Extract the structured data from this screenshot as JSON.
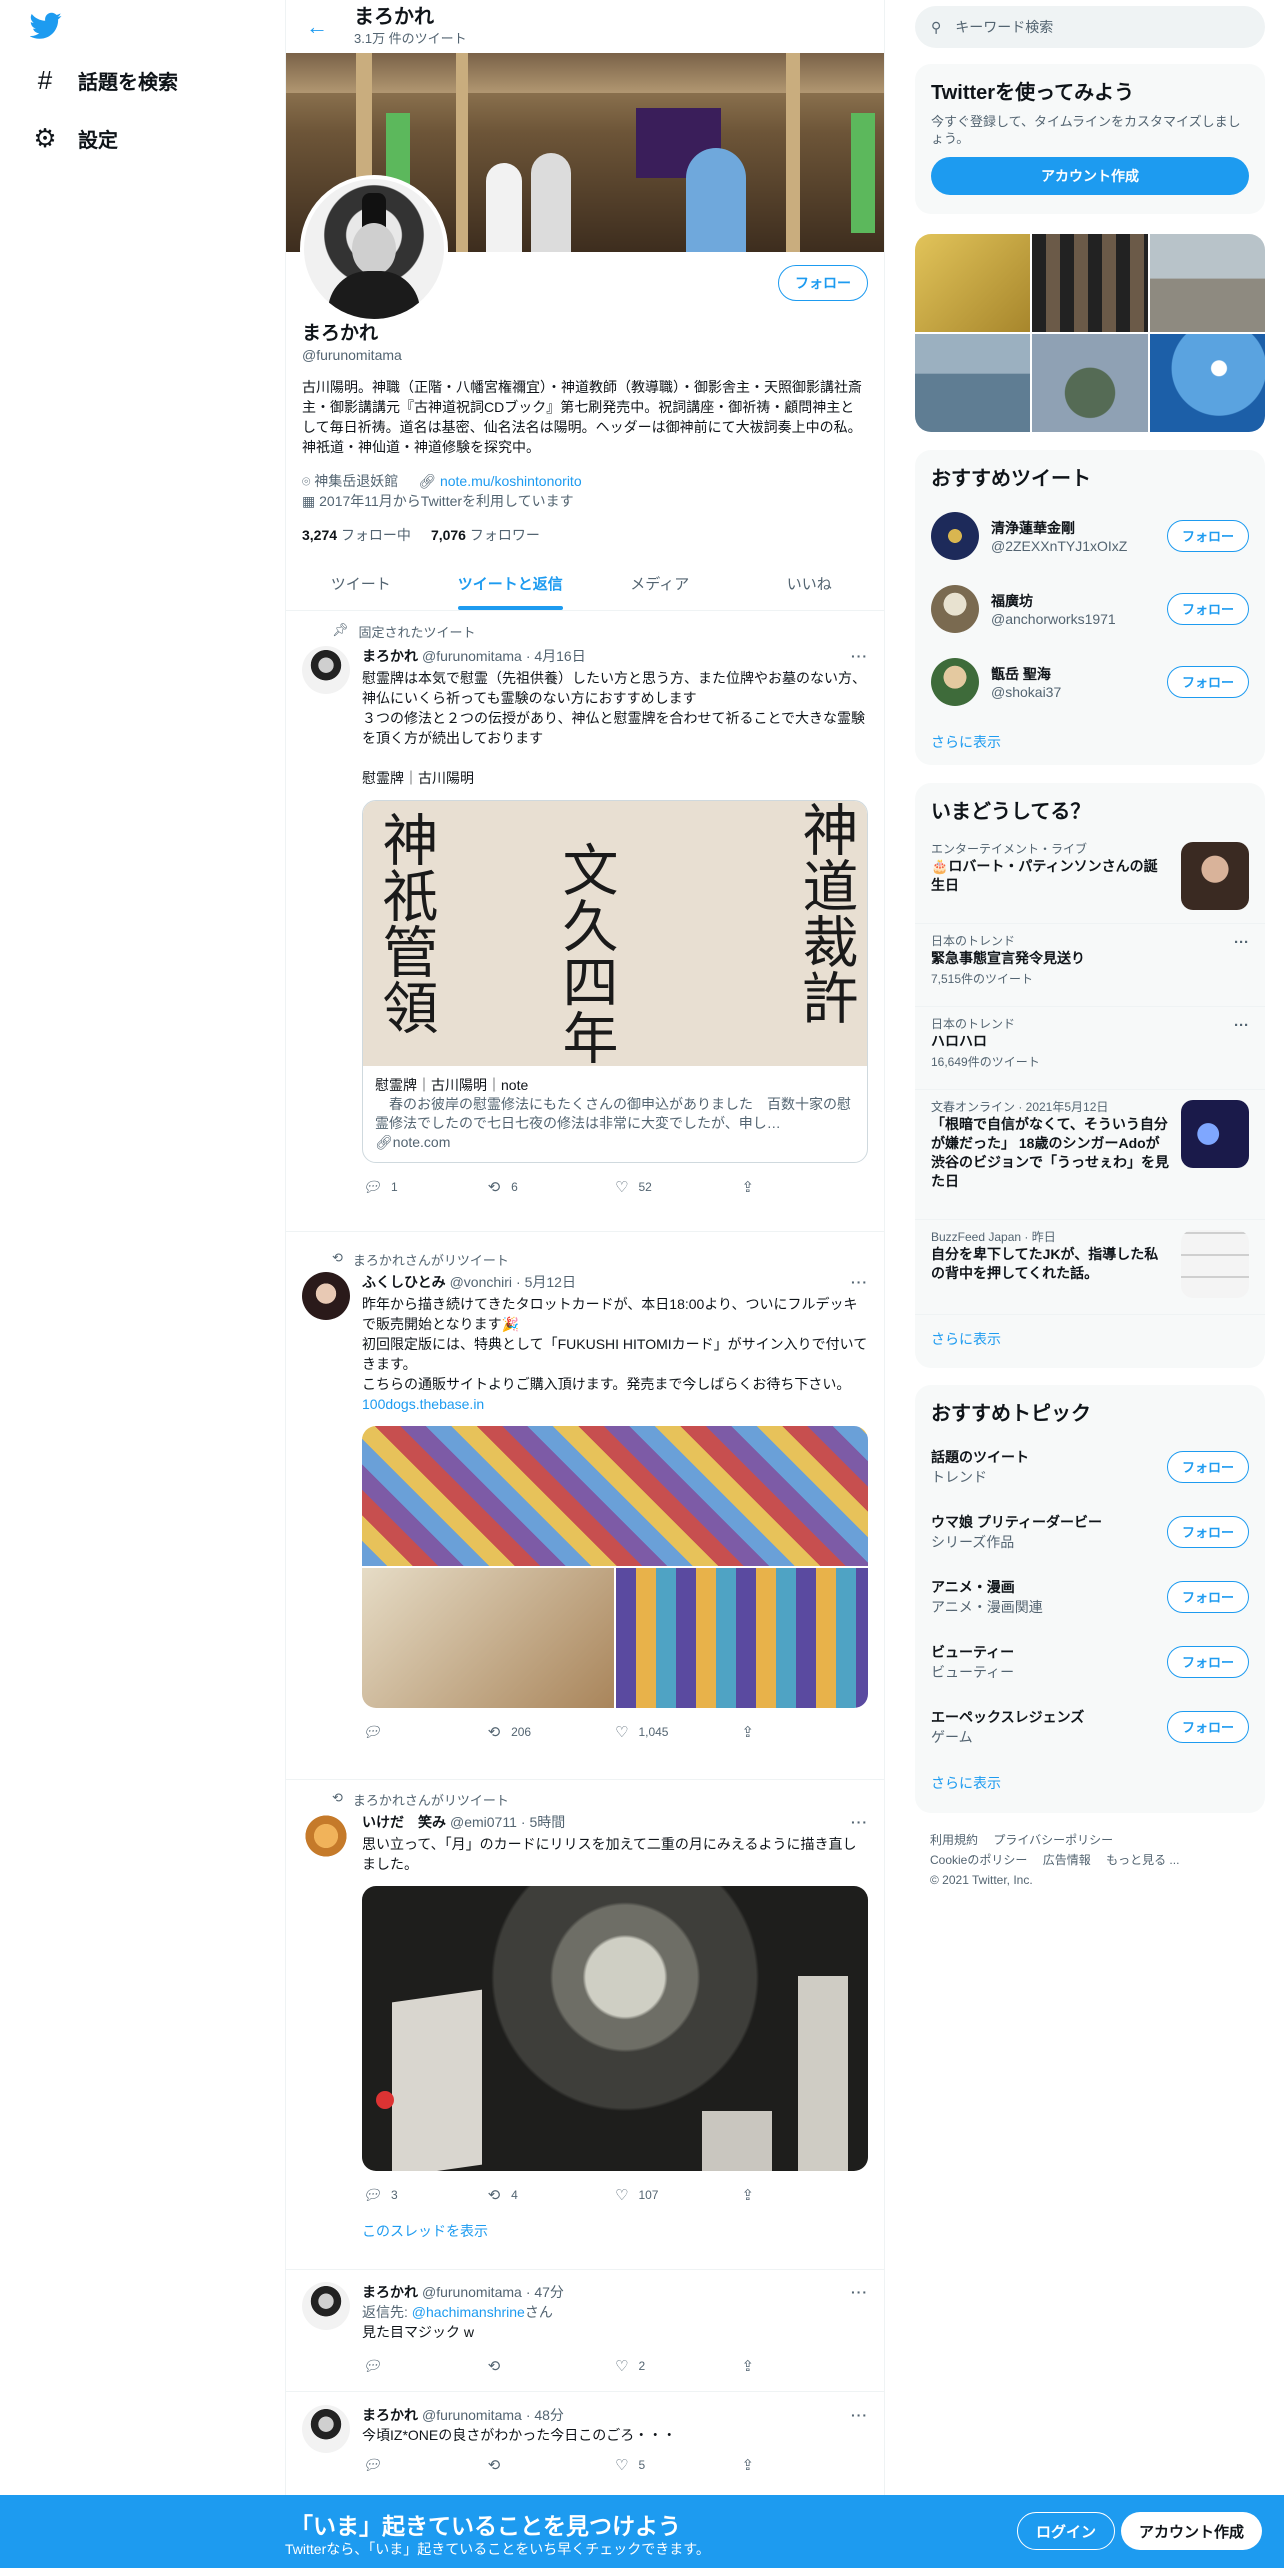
{
  "nav": {
    "explore": "話題を検索",
    "settings": "設定"
  },
  "header": {
    "name": "まろかれ",
    "tweet_count": "3.1万 件のツイート"
  },
  "profile": {
    "follow": "フォロー",
    "name": "まろかれ",
    "handle": "@furunomitama",
    "bio": "古川陽明。神職（正階・八幡宮権禰宜）・神道教師（教導職）・御影舎主・天照御影講社斎主・御影講講元『古神道祝詞CDブック』第七刷発売中。祝詞講座・御祈祷・顧問神主として毎日祈祷。道名は基密、仙名法名は陽明。ヘッダーは御神前にて大祓詞奏上中の私。神祇道・神仙道・神道修験を探究中。",
    "location": "神集岳退妖館",
    "url": "note.mu/koshintonorito",
    "joined": "2017年11月からTwitterを利用しています",
    "following_num": "3,274",
    "following_label": "フォロー中",
    "followers_num": "7,076",
    "followers_label": "フォロワー"
  },
  "tabs": [
    "ツイート",
    "ツイートと返信",
    "メディア",
    "いいね"
  ],
  "tweets": [
    {
      "context": "固定されたツイート",
      "name": "まろかれ",
      "handle": "@furunomitama",
      "time": "· 4月16日",
      "text": "慰霊牌は本気で慰霊（先祖供養）したい方と思う方、また位牌やお墓のない方、神仏にいくら祈っても霊験のない方におすすめします\n３つの修法と２つの伝授があり、神仏と慰霊牌を合わせて祈ることで大きな霊験を頂く方が続出しております\n\n慰霊牌｜古川陽明",
      "card_title": "慰霊牌｜古川陽明｜note",
      "card_desc": "　春のお彼岸の慰霊修法にもたくさんの御申込がありました　百数十家の慰霊修法でしたので七日七夜の修法は非常に大変でしたが、申し…",
      "card_url": "note.com",
      "card_kanji_1": "神道裁許",
      "card_kanji_2": "文久四年",
      "card_kanji_3": "神祇管領",
      "replies": "1",
      "retweets": "6",
      "likes": "52"
    },
    {
      "context": "まろかれさんがリツイート",
      "name": "ふくしひとみ",
      "handle": "@vonchiri",
      "time": "· 5月12日",
      "text": "昨年から描き続けてきたタロットカードが、本日18:00より、ついにフルデッキで販売開始となります🎉\n初回限定版には、特典として「FUKUSHI HITOMIカード」がサイン入りで付いてきます。\nこちらの通販サイトよりご購入頂けます。発売まで今しばらくお待ち下さい。",
      "link": "100dogs.thebase.in",
      "replies": "",
      "retweets": "206",
      "likes": "1,045"
    },
    {
      "context": "まろかれさんがリツイート",
      "name": "いけだ　笑み",
      "handle": "@emi0711",
      "time": "· 5時間",
      "text": "思い立って、「月」のカードにリリスを加えて二重の月にみえるように描き直しました。",
      "replies": "3",
      "retweets": "4",
      "likes": "107",
      "thread": "このスレッドを表示"
    },
    {
      "name": "まろかれ",
      "handle": "@furunomitama",
      "time": "· 47分",
      "reply_to_label": "返信先: ",
      "reply_to": "@hachimanshrine",
      "reply_to_suffix": "さん",
      "text": "見た目マジック w",
      "replies": "",
      "retweets": "",
      "likes": "2"
    },
    {
      "name": "まろかれ",
      "handle": "@furunomitama",
      "time": "· 48分",
      "text": "今頃IZ*ONEの良さがわかった今日このごろ・・・",
      "replies": "",
      "retweets": "",
      "likes": "5"
    }
  ],
  "right": {
    "search_placeholder": "キーワード検索",
    "signup_title": "Twitterを使ってみよう",
    "signup_sub": "今すぐ登録して、タイムラインをカスタマイズしましょう。",
    "signup_btn": "アカウント作成",
    "suggested_title": "おすすめツイート",
    "suggested": [
      {
        "name": "清浄蓮華金剛",
        "handle": "@2ZEXXnTYJ1xOIxZ",
        "follow": "フォロー"
      },
      {
        "name": "福廣坊",
        "handle": "@anchorworks1971",
        "follow": "フォロー"
      },
      {
        "name": "甑岳 聖海",
        "handle": "@shokai37",
        "follow": "フォロー"
      }
    ],
    "show_more": "さらに表示",
    "trends_title": "いまどうしてる？",
    "trends": [
      {
        "context": "エンターテイメント・ライブ",
        "name": "🎂ロバート・パティンソンさんの誕生日",
        "count": ""
      },
      {
        "context": "日本のトレンド",
        "name": "緊急事態宣言発令見送り",
        "count": "7,515件のツイート"
      },
      {
        "context": "日本のトレンド",
        "name": "ハロハロ",
        "count": "16,649件のツイート"
      },
      {
        "context": "文春オンライン · 2021年5月12日",
        "name": "「根暗で自信がなくて、そういう自分が嫌だった」 18歳のシンガーAdoが渋谷のビジョンで「うっせぇわ」を見た日",
        "count": ""
      },
      {
        "context": "BuzzFeed Japan · 昨日",
        "name": "自分を卑下してたJKが、指導した私の背中を押してくれた話。",
        "count": ""
      }
    ],
    "topics_title": "おすすめトピック",
    "topics": [
      {
        "name": "話題のツイート",
        "sub": "トレンド",
        "follow": "フォロー"
      },
      {
        "name": "ウマ娘 プリティーダービー",
        "sub": "シリーズ作品",
        "follow": "フォロー"
      },
      {
        "name": "アニメ・漫画",
        "sub": "アニメ・漫画関連",
        "follow": "フォロー"
      },
      {
        "name": "ビューティー",
        "sub": "ビューティー",
        "follow": "フォロー"
      },
      {
        "name": "エーペックスレジェンズ",
        "sub": "ゲーム",
        "follow": "フォロー"
      }
    ],
    "footer": {
      "terms": "利用規約",
      "privacy": "プライバシーポリシー",
      "cookie": "Cookieのポリシー",
      "ads": "広告情報",
      "more": "もっと見る ...",
      "copyright": "© 2021 Twitter, Inc."
    }
  },
  "bottom": {
    "title": "「いま」起きていることを見つけよう",
    "sub": "Twitterなら、「いま」起きていることをいち早くチェックできます。",
    "login": "ログイン",
    "signup": "アカウント作成"
  },
  "colors": {
    "accent": "#1d9bf0",
    "text": "#0f1419",
    "muted": "#536471"
  }
}
